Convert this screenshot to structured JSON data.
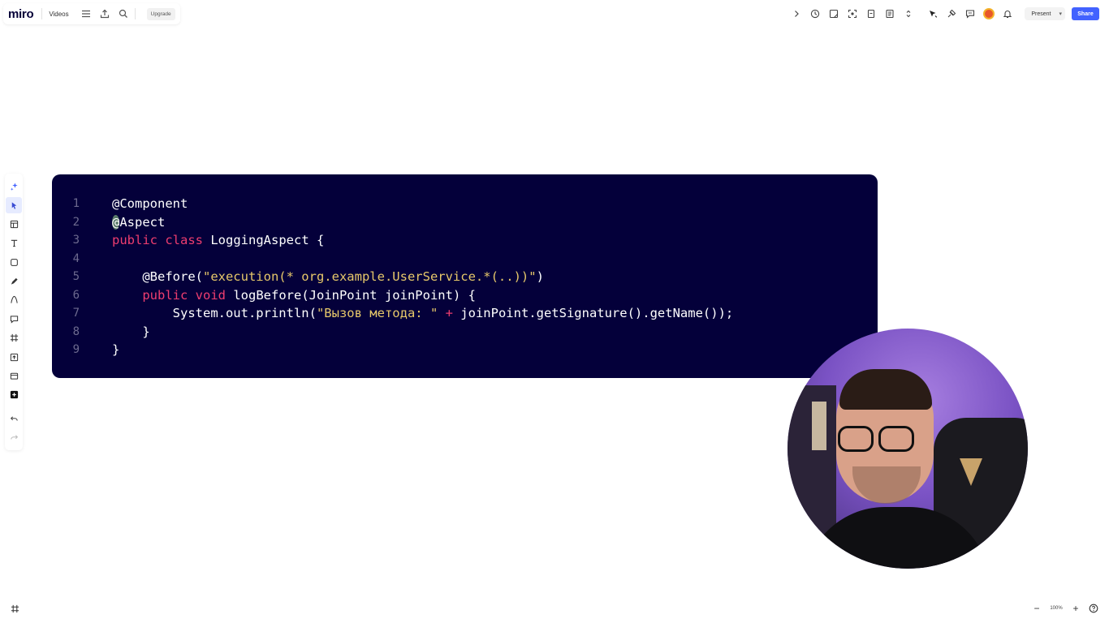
{
  "header": {
    "logo": "miro",
    "board_name": "Videos",
    "upgrade_label": "Upgrade"
  },
  "top_right": {
    "present_label": "Present",
    "share_label": "Share"
  },
  "code": {
    "lines": [
      {
        "num": "1",
        "parts": [
          {
            "t": "@Component",
            "c": "plain"
          }
        ]
      },
      {
        "num": "2",
        "parts": [
          {
            "t": "@",
            "c": "cursor"
          },
          {
            "t": "Aspect",
            "c": "plain"
          }
        ]
      },
      {
        "num": "3",
        "parts": [
          {
            "t": "public",
            "c": "kw"
          },
          {
            "t": " ",
            "c": "plain"
          },
          {
            "t": "class",
            "c": "kw"
          },
          {
            "t": " LoggingAspect {",
            "c": "plain"
          }
        ]
      },
      {
        "num": "4",
        "parts": []
      },
      {
        "num": "5",
        "parts": [
          {
            "t": "    @Before(",
            "c": "plain"
          },
          {
            "t": "\"execution(* org.example.UserService.*(..))\"",
            "c": "str"
          },
          {
            "t": ")",
            "c": "plain"
          }
        ]
      },
      {
        "num": "6",
        "parts": [
          {
            "t": "    ",
            "c": "plain"
          },
          {
            "t": "public",
            "c": "kw"
          },
          {
            "t": " ",
            "c": "plain"
          },
          {
            "t": "void",
            "c": "kw"
          },
          {
            "t": " logBefore(JoinPoint joinPoint) {",
            "c": "plain"
          }
        ]
      },
      {
        "num": "7",
        "parts": [
          {
            "t": "        System.out.println(",
            "c": "plain"
          },
          {
            "t": "\"Вызов метода: \"",
            "c": "str"
          },
          {
            "t": " ",
            "c": "plain"
          },
          {
            "t": "+",
            "c": "kw"
          },
          {
            "t": " joinPoint.getSignature().getName());",
            "c": "plain"
          }
        ]
      },
      {
        "num": "8",
        "parts": [
          {
            "t": "    }",
            "c": "plain"
          }
        ]
      },
      {
        "num": "9",
        "parts": [
          {
            "t": "}",
            "c": "plain"
          }
        ]
      }
    ]
  },
  "zoom": {
    "value": "100%"
  },
  "colors": {
    "code_bg": "#04003a",
    "keyword": "#ee3d6f",
    "string": "#e7c86a",
    "line_number": "#6d6a8f",
    "share_button": "#4262ff"
  },
  "icons": {
    "top_left": [
      "menu-icon",
      "export-icon",
      "search-icon"
    ],
    "top_right": [
      "chevron-right-icon",
      "timer-icon",
      "sticky-icon",
      "focus-icon",
      "document-icon",
      "notes-icon",
      "more-icon",
      "cursor-icon",
      "reactions-icon",
      "comment-icon",
      "avatar",
      "bell-icon"
    ],
    "left_toolbar": [
      "ai-sparkle-icon",
      "select-icon",
      "templates-icon",
      "text-icon",
      "shape-icon",
      "pen-icon",
      "connection-icon",
      "comment-icon",
      "frame-icon",
      "upload-icon",
      "card-icon",
      "plus-icon",
      "undo-icon",
      "redo-icon"
    ]
  }
}
